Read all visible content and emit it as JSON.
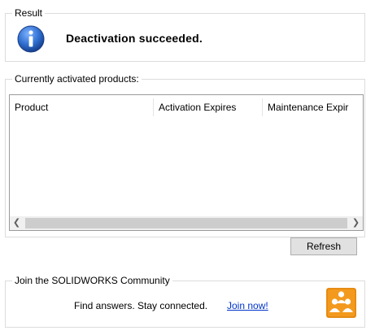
{
  "result": {
    "group_label": "Result",
    "message": "Deactivation succeeded."
  },
  "products": {
    "group_label": "Currently activated products:",
    "columns": [
      "Product",
      "Activation Expires",
      "Maintenance Expir"
    ],
    "refresh_label": "Refresh"
  },
  "community": {
    "group_label": "Join the SOLIDWORKS Community",
    "tagline": "Find answers. Stay connected.",
    "link_label": "Join now!"
  },
  "icons": {
    "info": "info-icon",
    "community": "community-icon",
    "scroll_left": "chevron-left-icon",
    "scroll_right": "chevron-right-icon"
  },
  "colors": {
    "info_blue": "#1f5fb8",
    "community_orange": "#f39a1e",
    "link": "#0033cc"
  }
}
